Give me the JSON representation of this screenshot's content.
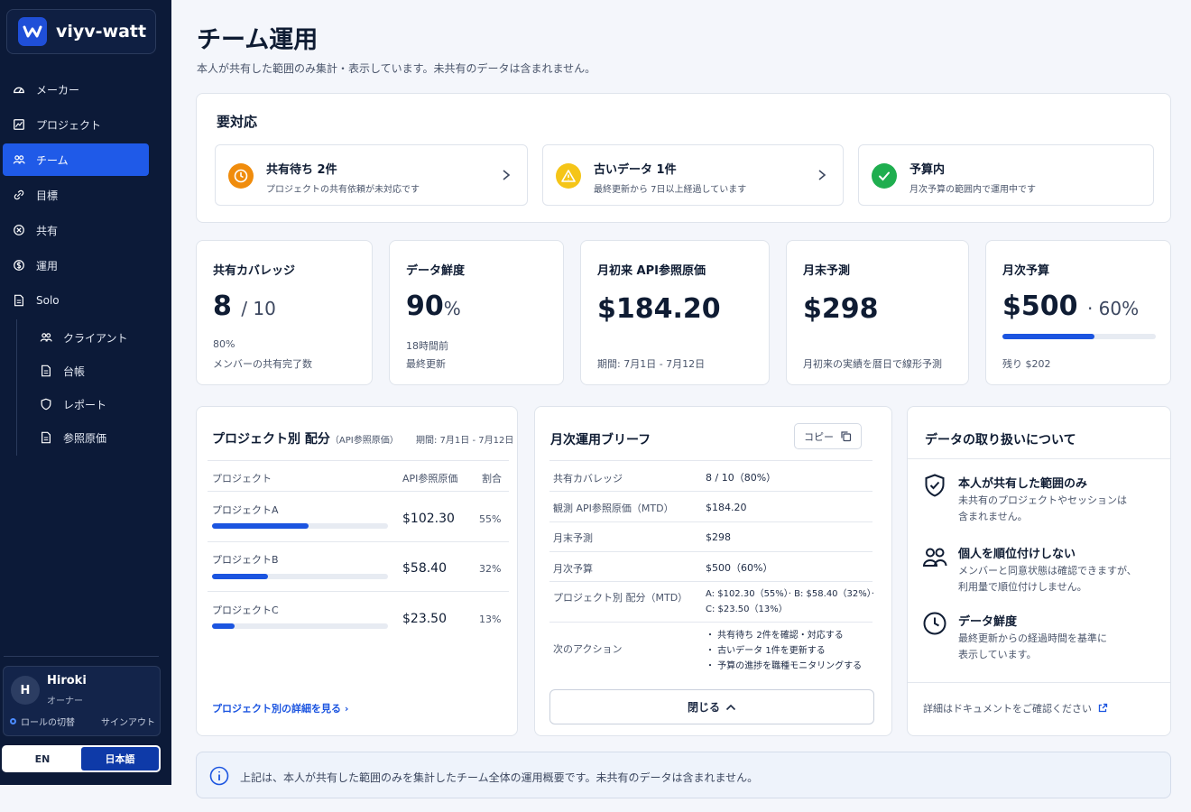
{
  "app": {
    "name": "viyv-watt"
  },
  "nav": {
    "items": [
      {
        "label": "メーカー",
        "icon": "gauge-icon"
      },
      {
        "label": "プロジェクト",
        "icon": "chart-icon"
      },
      {
        "label": "チーム",
        "icon": "users-icon",
        "active": true
      },
      {
        "label": "目標",
        "icon": "link-icon"
      },
      {
        "label": "共有",
        "icon": "circle-x-icon"
      },
      {
        "label": "運用",
        "icon": "dollar-circle-icon"
      },
      {
        "label": "Solo",
        "icon": "document-icon"
      }
    ],
    "sub_items": [
      {
        "label": "クライアント",
        "icon": "users-icon"
      },
      {
        "label": "台帳",
        "icon": "document-icon"
      },
      {
        "label": "レポート",
        "icon": "shield-icon"
      },
      {
        "label": "参照原価",
        "icon": "document-icon"
      }
    ]
  },
  "user": {
    "initial": "H",
    "name": "Hiroki",
    "role": "オーナー",
    "role_switch": "ロールの切替",
    "signout": "サインアウト"
  },
  "lang": {
    "en": "EN",
    "ja": "日本語",
    "active": "ja"
  },
  "page": {
    "title": "チーム運用",
    "subtitle": "本人が共有した範囲のみ集計・表示しています。未共有のデータは含まれません。"
  },
  "alerts": {
    "title": "要対応",
    "items": [
      {
        "title": "共有待ち 2件",
        "desc": "プロジェクトの共有依頼が未対応です",
        "color": "#f08c0c",
        "icon": "clock-icon"
      },
      {
        "title": "古いデータ 1件",
        "desc": "最終更新から 7日以上経過しています",
        "color": "#f5c518",
        "icon": "warning-icon"
      },
      {
        "title": "予算内",
        "desc": "月次予算の範囲内で運用中です",
        "color": "#1fae4f",
        "icon": "check-icon"
      }
    ]
  },
  "kpis": {
    "coverage": {
      "label": "共有カバレッジ",
      "value": "8",
      "total": "/ 10",
      "sub1": "80%",
      "sub2": "メンバーの共有完了数"
    },
    "freshness": {
      "label": "データ鮮度",
      "value": "90",
      "unit": "%",
      "sub1": "18時間前",
      "sub2": "最終更新"
    },
    "mtd_cost": {
      "label": "月初来 API参照原価",
      "value": "$184.20",
      "sub1": "期間: 7月1日 - 7月12日"
    },
    "forecast": {
      "label": "月末予測",
      "value": "$298",
      "sub1": "月初来の実績を暦日で線形予測"
    },
    "budget": {
      "label": "月次予算",
      "value": "$500",
      "pct": "· 60%",
      "progress": 0.6,
      "sub1": "残り $202"
    }
  },
  "projects": {
    "title": "プロジェクト別 配分",
    "note": "（API参照原価）",
    "period": "期間: 7月1日 - 7月12日",
    "headers": {
      "name": "プロジェクト",
      "cost": "API参照原価",
      "share": "割合"
    },
    "rows": [
      {
        "name": "プロジェクトA",
        "cost": "$102.30",
        "share": "55%",
        "progress": 0.55
      },
      {
        "name": "プロジェクトB",
        "cost": "$58.40",
        "share": "32%",
        "progress": 0.32
      },
      {
        "name": "プロジェクトC",
        "cost": "$23.50",
        "share": "13%",
        "progress": 0.13
      }
    ],
    "link": "プロジェクト別の詳細を見る"
  },
  "brief": {
    "title": "月次運用ブリーフ",
    "copy": "コピー",
    "rows": [
      {
        "k": "共有カバレッジ",
        "v": "8 / 10（80%）"
      },
      {
        "k": "観測 API参照原価（MTD）",
        "v": "$184.20"
      },
      {
        "k": "月末予測",
        "v": "$298"
      },
      {
        "k": "月次予算",
        "v": "$500（60%）"
      },
      {
        "k": "プロジェクト別 配分（MTD）",
        "v1": "A: $102.30（55%）· B: $58.40（32%）·",
        "v2": "C: $23.50（13%）"
      },
      {
        "k": "次のアクション",
        "a1": "・ 共有待ち 2件を確認・対応する",
        "a2": "・ 古いデータ 1件を更新する",
        "a3": "・ 予算の進捗を職種モニタリングする"
      }
    ],
    "close": "閉じる"
  },
  "policy": {
    "title": "データの取り扱いについて",
    "items": [
      {
        "title": "本人が共有した範囲のみ",
        "d1": "未共有のプロジェクトやセッションは",
        "d2": "含まれません。",
        "icon": "shield-check-icon"
      },
      {
        "title": "個人を順位付けしない",
        "d1": "メンバーと同意状態は確認できますが、",
        "d2": "利用量で順位付けしません。",
        "icon": "users-icon"
      },
      {
        "title": "データ鮮度",
        "d1": "最終更新からの経過時間を基準に",
        "d2": "表示しています。",
        "icon": "clock-icon"
      }
    ],
    "link": "詳細はドキュメントをご確認ください"
  },
  "info": {
    "text": "上記は、本人が共有した範囲のみを集計したチーム全体の運用概要です。未共有のデータは含まれません。"
  }
}
